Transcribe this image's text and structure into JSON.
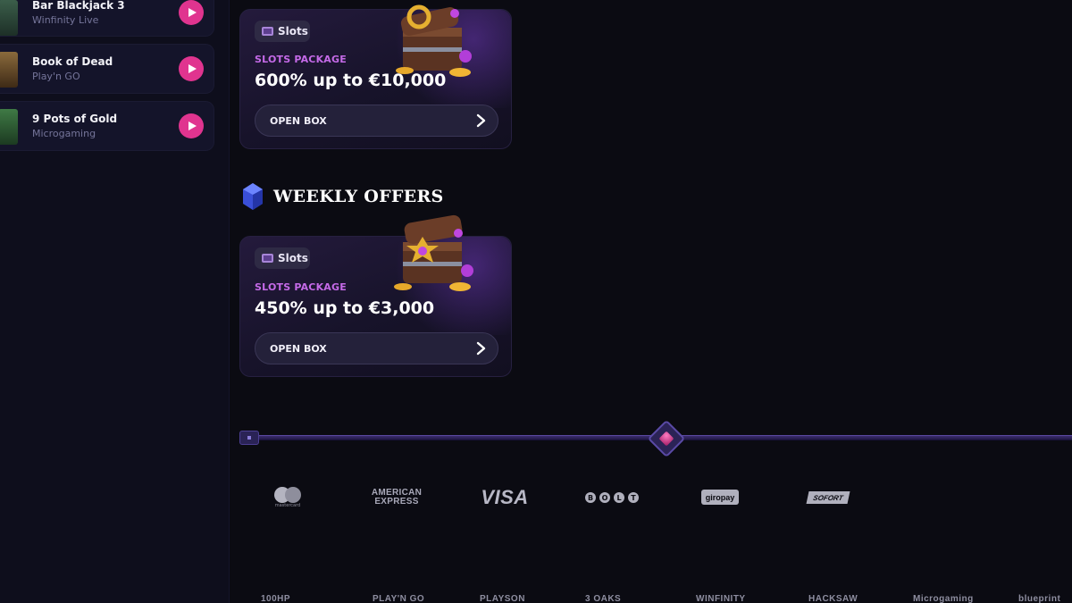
{
  "sidebar": {
    "games": [
      {
        "name": "Bar Blackjack 3",
        "provider": "Winfinity Live",
        "thumb_color": "#2f4a3a"
      },
      {
        "name": "Book of Dead",
        "provider": "Play'n GO",
        "thumb_color": "#6b4a2a"
      },
      {
        "name": "9 Pots of Gold",
        "provider": "Microgaming",
        "thumb_color": "#2c5a34"
      }
    ]
  },
  "offers": {
    "top_card": {
      "tag": "Slots",
      "package_label": "SLOTS PACKAGE",
      "amount": "600% up to €10,000",
      "button": "OPEN BOX"
    },
    "weekly_title": "WEEKLY OFFERS",
    "weekly_card": {
      "tag": "Slots",
      "package_label": "SLOTS PACKAGE",
      "amount": "450% up to €3,000",
      "button": "OPEN BOX"
    }
  },
  "payments": {
    "mastercard": "mastercard",
    "amex_line1": "AMERICAN",
    "amex_line2": "EXPRESS",
    "visa": "VISA",
    "bolt": [
      "B",
      "O",
      "L",
      "T"
    ],
    "giropay": "giropay",
    "sofort": "SOFORT"
  },
  "providers": [
    "100HP",
    "PLAY'N GO",
    "PLAYSON",
    "3 OAKS",
    "WINFINITY",
    "HACKSAW",
    "Microgaming",
    "blueprint"
  ],
  "colors": {
    "accent": "#e0348f",
    "package_label": "#c56ae8",
    "background": "#0b0b12"
  }
}
